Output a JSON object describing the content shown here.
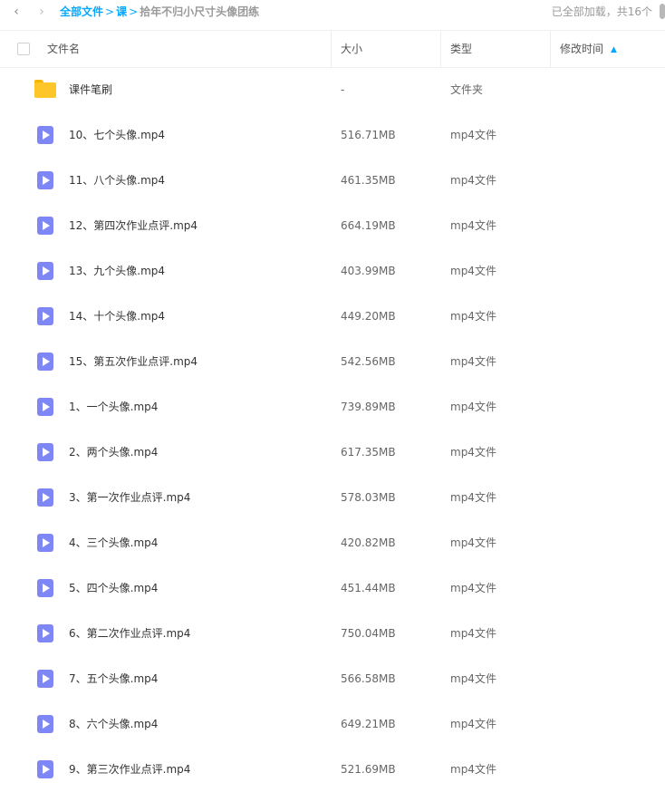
{
  "nav": {
    "back_glyph": "‹",
    "forward_glyph": "›",
    "back_icon": "chevron-left-icon",
    "forward_icon": "chevron-right-icon"
  },
  "breadcrumb": {
    "root": "全部文件",
    "separator": ">",
    "parent": "课",
    "current": "拾年不归小尺寸头像团练"
  },
  "status": {
    "loaded_text": "已全部加载，共16个"
  },
  "columns": {
    "name": "文件名",
    "size": "大小",
    "type": "类型",
    "modified": "修改时间"
  },
  "colors": {
    "accent": "#06a7ff",
    "folder": "#ffc629",
    "video": "#7f86f6"
  },
  "files": [
    {
      "icon": "folder-icon",
      "name": "课件笔刷",
      "size": "-",
      "type": "文件夹"
    },
    {
      "icon": "video-file-icon",
      "name": "10、七个头像.mp4",
      "size": "516.71MB",
      "type": "mp4文件"
    },
    {
      "icon": "video-file-icon",
      "name": "11、八个头像.mp4",
      "size": "461.35MB",
      "type": "mp4文件"
    },
    {
      "icon": "video-file-icon",
      "name": "12、第四次作业点评.mp4",
      "size": "664.19MB",
      "type": "mp4文件"
    },
    {
      "icon": "video-file-icon",
      "name": "13、九个头像.mp4",
      "size": "403.99MB",
      "type": "mp4文件"
    },
    {
      "icon": "video-file-icon",
      "name": "14、十个头像.mp4",
      "size": "449.20MB",
      "type": "mp4文件"
    },
    {
      "icon": "video-file-icon",
      "name": "15、第五次作业点评.mp4",
      "size": "542.56MB",
      "type": "mp4文件"
    },
    {
      "icon": "video-file-icon",
      "name": "1、一个头像.mp4",
      "size": "739.89MB",
      "type": "mp4文件"
    },
    {
      "icon": "video-file-icon",
      "name": "2、两个头像.mp4",
      "size": "617.35MB",
      "type": "mp4文件"
    },
    {
      "icon": "video-file-icon",
      "name": "3、第一次作业点评.mp4",
      "size": "578.03MB",
      "type": "mp4文件"
    },
    {
      "icon": "video-file-icon",
      "name": "4、三个头像.mp4",
      "size": "420.82MB",
      "type": "mp4文件"
    },
    {
      "icon": "video-file-icon",
      "name": "5、四个头像.mp4",
      "size": "451.44MB",
      "type": "mp4文件"
    },
    {
      "icon": "video-file-icon",
      "name": "6、第二次作业点评.mp4",
      "size": "750.04MB",
      "type": "mp4文件"
    },
    {
      "icon": "video-file-icon",
      "name": "7、五个头像.mp4",
      "size": "566.58MB",
      "type": "mp4文件"
    },
    {
      "icon": "video-file-icon",
      "name": "8、六个头像.mp4",
      "size": "649.21MB",
      "type": "mp4文件"
    },
    {
      "icon": "video-file-icon",
      "name": "9、第三次作业点评.mp4",
      "size": "521.69MB",
      "type": "mp4文件"
    }
  ]
}
